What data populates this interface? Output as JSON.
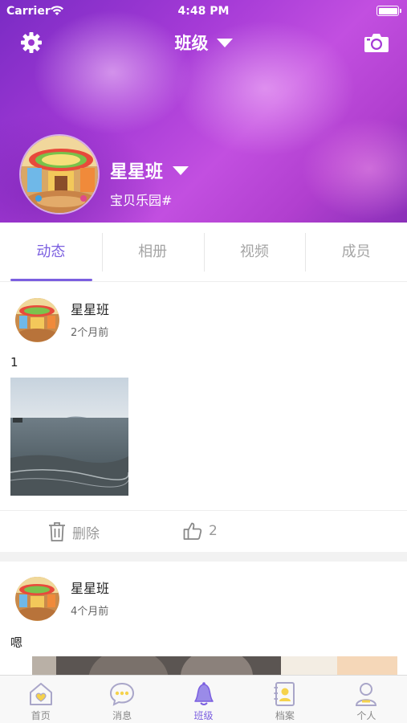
{
  "status_bar": {
    "carrier": "Carrier",
    "time": "4:48 PM"
  },
  "nav": {
    "title": "班级",
    "left_icon": "gear-icon",
    "right_icon": "camera-icon"
  },
  "class_info": {
    "name": "星星班",
    "school": "宝贝乐园#"
  },
  "tabs": [
    {
      "label": "动态",
      "active": true
    },
    {
      "label": "相册",
      "active": false
    },
    {
      "label": "视频",
      "active": false
    },
    {
      "label": "成员",
      "active": false
    }
  ],
  "posts": [
    {
      "author": "星星班",
      "time": "2个月前",
      "text": "1",
      "delete_label": "删除",
      "likes": "2"
    },
    {
      "author": "星星班",
      "time": "4个月前",
      "text": "嗯"
    }
  ],
  "tabbar": [
    {
      "label": "首页",
      "icon": "home-heart-icon",
      "active": false
    },
    {
      "label": "消息",
      "icon": "chat-bubble-icon",
      "active": false
    },
    {
      "label": "班级",
      "icon": "bell-icon",
      "active": true
    },
    {
      "label": "档案",
      "icon": "profile-card-icon",
      "active": false
    },
    {
      "label": "个人",
      "icon": "person-icon",
      "active": false
    }
  ],
  "colors": {
    "accent": "#7b5fe0",
    "header_purple": "#a43ad6",
    "inactive_text": "#a5a5a5"
  }
}
